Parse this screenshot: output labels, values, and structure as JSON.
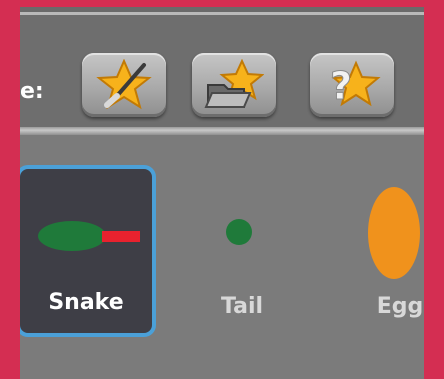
{
  "toolbar": {
    "label": "e:",
    "buttons": [
      {
        "id": "edit",
        "icon": "star-paintbrush-icon"
      },
      {
        "id": "open",
        "icon": "star-folder-icon"
      },
      {
        "id": "help",
        "icon": "star-question-icon"
      }
    ]
  },
  "sprites": [
    {
      "name": "Snake",
      "selected": true
    },
    {
      "name": "Tail",
      "selected": false
    },
    {
      "name": "Egg",
      "selected": false
    }
  ],
  "colors": {
    "background": "#d42e52",
    "selection_border": "#4ba0d8",
    "snake_green": "#1f7a3a",
    "snake_red": "#e8222e",
    "egg_orange": "#f0921c"
  }
}
